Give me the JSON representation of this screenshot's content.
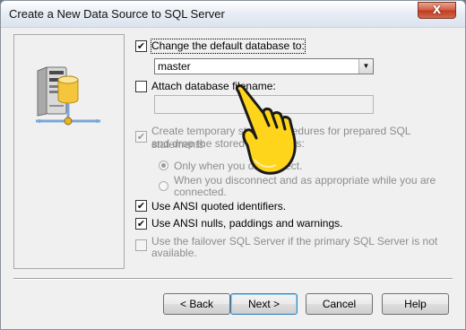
{
  "window": {
    "title": "Create a New Data Source to SQL Server",
    "close_label": "X"
  },
  "options": {
    "change_default_db": {
      "label": "Change the default database to:",
      "checked": true
    },
    "database_combo": {
      "value": "master"
    },
    "attach_db_file": {
      "label": "Attach database filename:",
      "checked": false
    },
    "create_temp_procs": {
      "label_line1": "Create temporary stored procedures for prepared SQL statements",
      "label_line2": "and drop the stored procedures:",
      "checked": true,
      "enabled": false
    },
    "radio_only_disconnect": {
      "label": "Only when you disconnect.",
      "selected": true
    },
    "radio_disconnect_and": {
      "label_line1": "When you disconnect and as appropriate while you are",
      "label_line2": "connected.",
      "selected": false
    },
    "ansi_quoted": {
      "label": "Use ANSI quoted identifiers.",
      "checked": true
    },
    "ansi_nulls": {
      "label": "Use ANSI nulls, paddings and warnings.",
      "checked": true
    },
    "failover": {
      "label_line1": "Use the failover SQL Server if the primary SQL Server is not",
      "label_line2": "available.",
      "checked": false,
      "enabled": false
    }
  },
  "buttons": {
    "back": "< Back",
    "next": "Next >",
    "cancel": "Cancel",
    "help": "Help"
  },
  "icons": {
    "checkmark": "✔",
    "combo_arrow": "▼"
  },
  "colors": {
    "close_button": "#c9452a",
    "hand_fill": "#ffd51c"
  }
}
